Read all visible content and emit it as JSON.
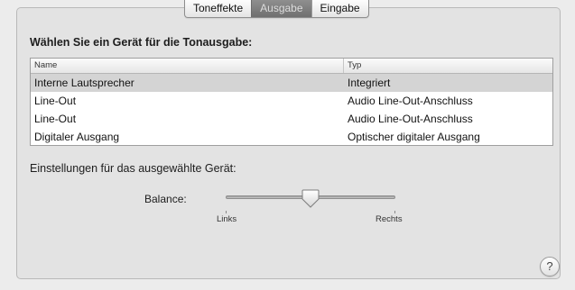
{
  "tabs": [
    {
      "label": "Toneffekte",
      "selected": false
    },
    {
      "label": "Ausgabe",
      "selected": true
    },
    {
      "label": "Eingabe",
      "selected": false
    }
  ],
  "heading": "Wählen Sie ein Gerät für die Tonausgabe:",
  "table": {
    "columns": [
      "Name",
      "Typ"
    ],
    "rows": [
      {
        "name": "Interne Lautsprecher",
        "type": "Integriert",
        "selected": true
      },
      {
        "name": "Line-Out",
        "type": "Audio Line-Out-Anschluss",
        "selected": false
      },
      {
        "name": "Line-Out",
        "type": "Audio Line-Out-Anschluss",
        "selected": false
      },
      {
        "name": "Digitaler Ausgang",
        "type": "Optischer digitaler Ausgang",
        "selected": false
      }
    ]
  },
  "settings_label": "Einstellungen für das ausgewählte Gerät:",
  "balance": {
    "label": "Balance:",
    "left_label": "Links",
    "right_label": "Rechts",
    "value": 0.5
  },
  "help_button": {
    "label": "?",
    "icon": "help-icon"
  },
  "colors": {
    "selected_tab": "#7f7f7f",
    "selected_row": "#d4d4d4"
  }
}
